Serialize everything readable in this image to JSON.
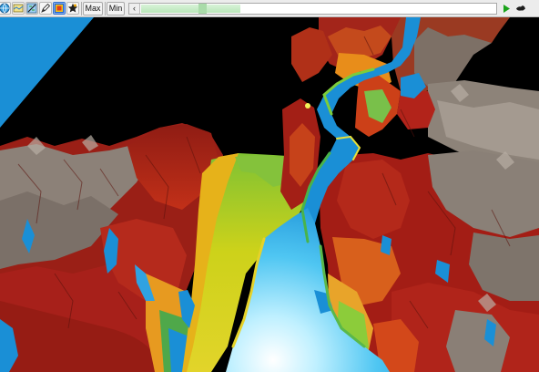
{
  "toolbar": {
    "tools": [
      {
        "name": "globe-icon"
      },
      {
        "name": "layers-icon"
      },
      {
        "name": "map-edit-icon"
      },
      {
        "name": "pen-icon"
      },
      {
        "name": "color-palette-icon"
      },
      {
        "name": "star-icon"
      }
    ],
    "max_label": "Max",
    "min_label": "Min",
    "slider_left_glyph": "‹",
    "slider_progress": 0.28,
    "play_icon": "play-icon",
    "stop_icon": "stop-icon"
  },
  "viewport": {
    "sky_color": "#000000",
    "water_color": "#1a8fd6",
    "water_highlight": "#dff6ff",
    "plain_color": "#d8d400",
    "ridge_color": "#b01b12",
    "peak_color": "#8a8179"
  }
}
